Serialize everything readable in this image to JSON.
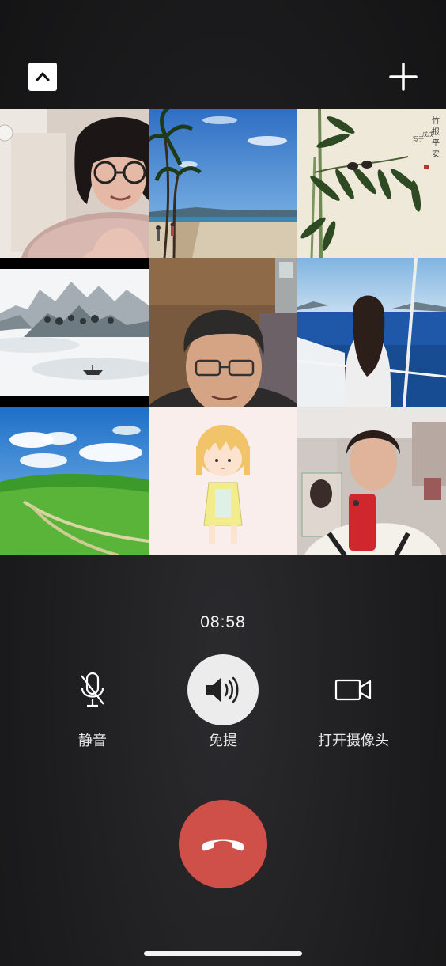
{
  "call": {
    "timer": "08:58",
    "controls": [
      {
        "label": "静音",
        "icon": "microphone-muted-icon"
      },
      {
        "label": "免提",
        "icon": "speaker-icon",
        "active": true
      },
      {
        "label": "打开摄像头",
        "icon": "camera-icon"
      }
    ],
    "hangup_icon": "phone-hangup-icon",
    "hangup_color": "#cf5048"
  },
  "top_bar": {
    "collapse_icon": "chevron-up-icon",
    "add_icon": "plus-icon"
  },
  "participants": [
    {
      "id": 1,
      "tile": "woman-with-glasses-video"
    },
    {
      "id": 2,
      "tile": "beach-palm-trees"
    },
    {
      "id": 3,
      "tile": "bamboo-birds-painting"
    },
    {
      "id": 4,
      "tile": "ink-landscape-painting"
    },
    {
      "id": 5,
      "tile": "man-with-glasses-video"
    },
    {
      "id": 6,
      "tile": "woman-on-boat-sea"
    },
    {
      "id": 7,
      "tile": "green-meadow-sky"
    },
    {
      "id": 8,
      "tile": "cartoon-girl-avatar"
    },
    {
      "id": 9,
      "tile": "woman-selfie-red-phone"
    }
  ],
  "painting_inscription": "竹报平安"
}
